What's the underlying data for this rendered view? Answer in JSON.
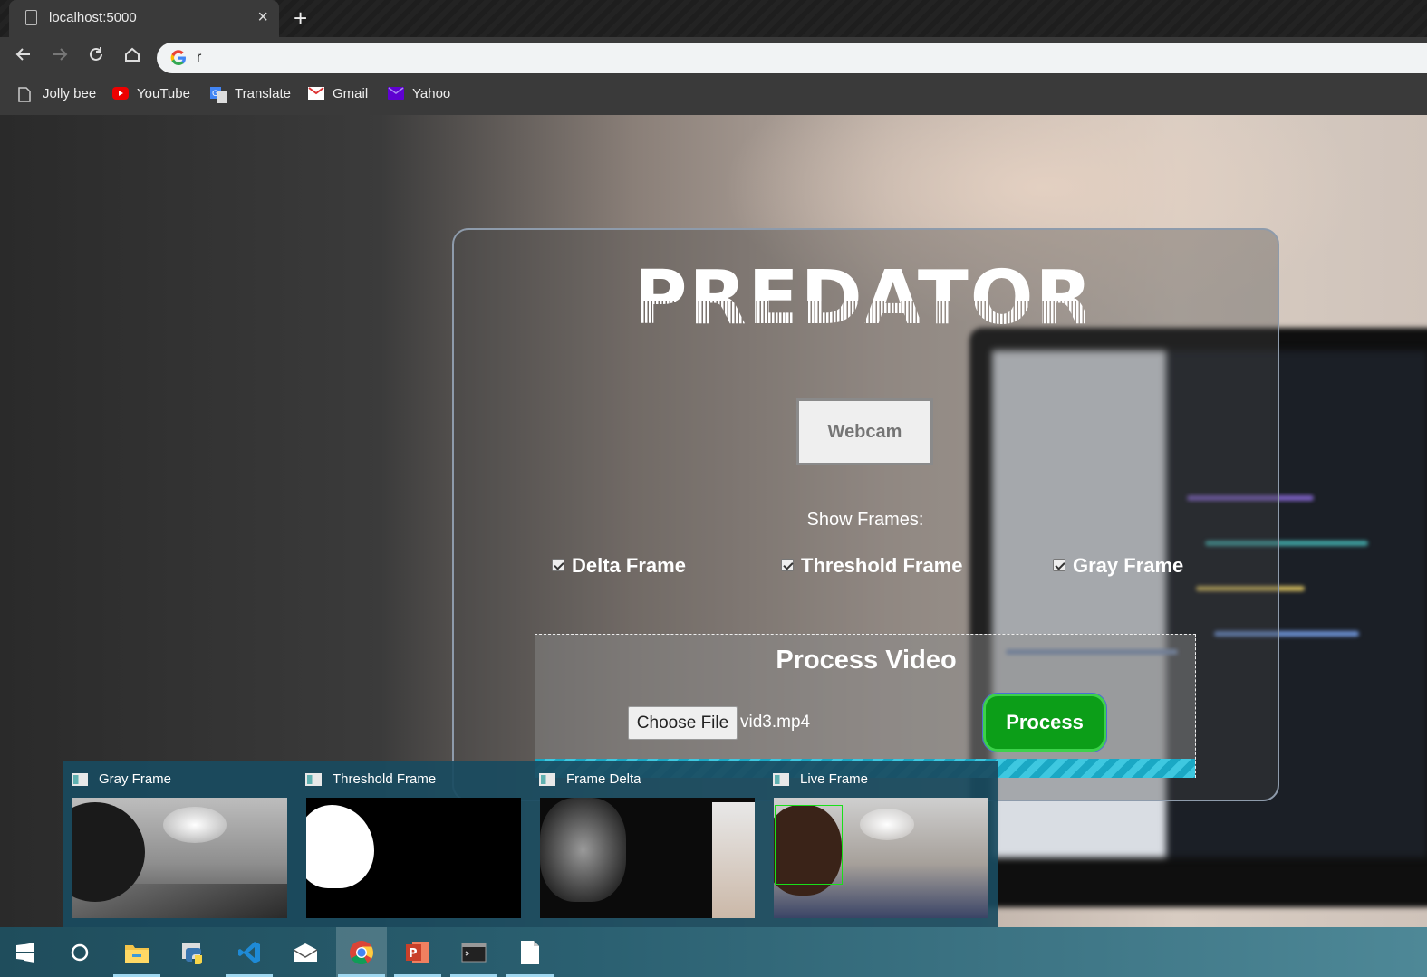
{
  "browser": {
    "tab_title": "localhost:5000",
    "close_glyph": "×",
    "new_tab_glyph": "+",
    "address_text": "r",
    "nav_icons": [
      "back-icon",
      "forward-icon",
      "reload-icon",
      "home-icon"
    ],
    "bookmarks": [
      {
        "label": "Jolly bee",
        "icon": "page-icon"
      },
      {
        "label": "YouTube",
        "icon": "youtube-icon"
      },
      {
        "label": "Translate",
        "icon": "translate-icon"
      },
      {
        "label": "Gmail",
        "icon": "gmail-icon"
      },
      {
        "label": "Yahoo",
        "icon": "yahoo-icon"
      }
    ]
  },
  "app": {
    "logo_text": "PREDATOR",
    "webcam_label": "Webcam",
    "show_frames_label": "Show Frames:",
    "checkboxes": [
      {
        "label": "Delta Frame",
        "checked": true
      },
      {
        "label": "Threshold Frame",
        "checked": true
      },
      {
        "label": "Gray Frame",
        "checked": true
      }
    ],
    "process_section": {
      "title": "Process Video",
      "choose_file_label": "Choose File",
      "file_name": "vid3.mp4",
      "process_label": "Process"
    }
  },
  "thumbnails": [
    {
      "title": "Gray Frame"
    },
    {
      "title": "Threshold Frame"
    },
    {
      "title": "Frame Delta"
    },
    {
      "title": "Live Frame"
    }
  ],
  "taskbar": {
    "items": [
      "start-icon",
      "cortana-icon",
      "file-explorer-icon",
      "python-icon",
      "vscode-icon",
      "mail-icon",
      "chrome-icon",
      "powerpoint-icon",
      "terminal-icon",
      "notepad-icon"
    ]
  },
  "colors": {
    "process_button": "#0c9e18",
    "progress_bar": "#1aa8c4",
    "thumbnail_bg": "#194b5f"
  }
}
